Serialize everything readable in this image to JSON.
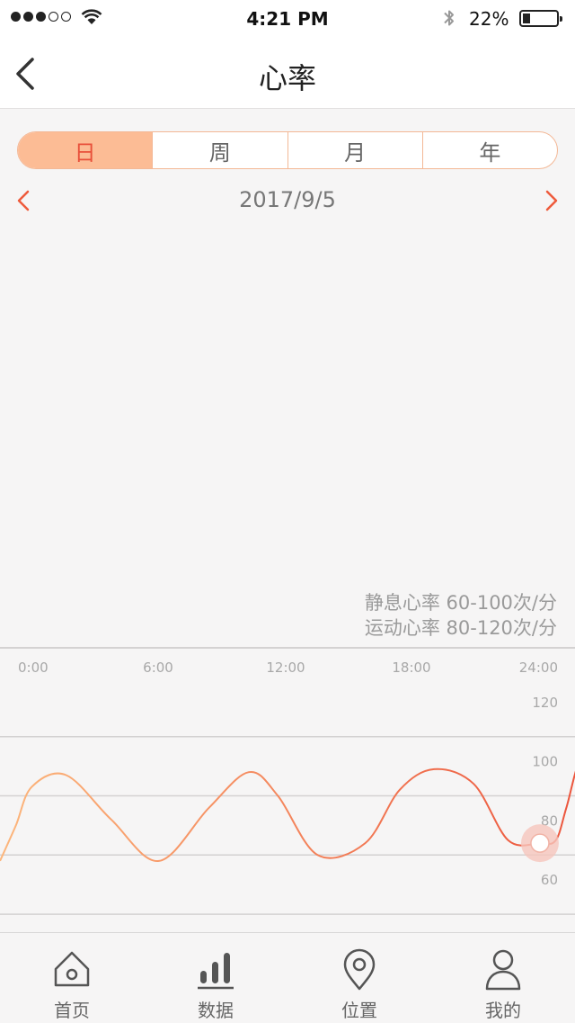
{
  "status_bar": {
    "time": "4:21 PM",
    "battery": "22%",
    "signal_bars": 3,
    "signal_total": 5,
    "battery_level": 0.22
  },
  "nav": {
    "title": "心率",
    "back_icon": "chevron-left-icon"
  },
  "segments": [
    {
      "label": "日",
      "active": true
    },
    {
      "label": "周",
      "active": false
    },
    {
      "label": "月",
      "active": false
    },
    {
      "label": "年",
      "active": false
    }
  ],
  "date": {
    "label": "2017/9/5",
    "prev_icon": "chevron-left-icon",
    "next_icon": "chevron-right-icon"
  },
  "legend": {
    "rest": "静息心率  60-100次/分",
    "exercise": "运动心率  80-120次/分"
  },
  "chart_data": {
    "type": "line",
    "title": "",
    "xlabel": "",
    "ylabel": "",
    "x_ticks": [
      "0:00",
      "6:00",
      "12:00",
      "18:00",
      "24:00"
    ],
    "y_ticks": [
      "120",
      "100",
      "80",
      "60"
    ],
    "xlim": [
      0,
      24
    ],
    "ylim": [
      40,
      140
    ],
    "grid": true,
    "series": [
      {
        "x": [
          0,
          0.6,
          1.2,
          2.5,
          4.2,
          6.0,
          7.9,
          9.4,
          10.5,
          12.0,
          13.8,
          15.1,
          16.4,
          17.9,
          19.2,
          20.4,
          21.0,
          21.4,
          22.0,
          23.0,
          24.0
        ],
        "y": [
          68,
          80,
          93,
          97,
          82,
          68,
          86,
          98,
          90,
          70,
          74,
          92,
          99,
          94,
          75,
          74,
          75,
          86,
          104,
          111,
          112
        ]
      }
    ],
    "marker": {
      "x": 20.4,
      "y": 74
    },
    "colors": {
      "start": "#fcb67c",
      "end": "#ea4b36",
      "marker_halo": "#f6c6bd"
    }
  },
  "tab_bar": [
    {
      "label": "首页",
      "icon": "home-icon"
    },
    {
      "label": "数据",
      "icon": "bar-chart-icon"
    },
    {
      "label": "位置",
      "icon": "location-pin-icon"
    },
    {
      "label": "我的",
      "icon": "user-icon"
    }
  ]
}
